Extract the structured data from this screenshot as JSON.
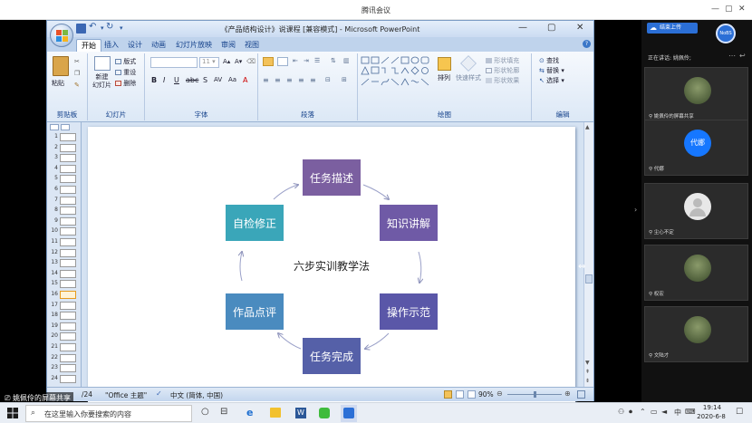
{
  "meeting": {
    "title": "腾讯会议",
    "now_speaking": "正在讲话: 姚佩伶;",
    "share_label": "姚佩伶的屏幕共享",
    "upload_btn": "结束上传"
  },
  "ppt": {
    "title": "《产品结构设计》说课程 [兼容模式] - Microsoft PowerPoint",
    "tabs": [
      "开始",
      "插入",
      "设计",
      "动画",
      "幻灯片放映",
      "审阅",
      "视图"
    ],
    "groups": {
      "clipboard": "剪贴板",
      "slides": "幻灯片",
      "font": "字体",
      "paragraph": "段落",
      "drawing": "绘图",
      "editing": "编辑"
    },
    "ribbon": {
      "paste": "粘贴",
      "new_slide": "新建\n幻灯片",
      "layout": "版式",
      "reset": "重设",
      "delete": "删除",
      "font_size": "11",
      "arrange": "排列",
      "quick_styles": "快速样式",
      "shape_fill": "形状填充",
      "shape_outline": "形状轮廓",
      "shape_effects": "形状效果",
      "find": "查找",
      "replace": "替换",
      "select": "选择"
    },
    "slide_numbers": [
      "1",
      "2",
      "3",
      "4",
      "5",
      "6",
      "7",
      "8",
      "9",
      "10",
      "11",
      "12",
      "13",
      "14",
      "15",
      "16",
      "17",
      "18",
      "19",
      "20",
      "21",
      "22",
      "23",
      "24"
    ],
    "current_slide": "16",
    "status": {
      "slide_count": "/24",
      "theme": "\"Office 主题\"",
      "language": "中文 (简体, 中国)",
      "zoom": "90%"
    },
    "diagram": {
      "center": "六步实训教学法",
      "steps": [
        "任务描述",
        "知识讲解",
        "操作示范",
        "任务完成",
        "作品点评",
        "自检修正"
      ]
    }
  },
  "participants": [
    {
      "name": "姚佩伶的屏幕共享",
      "avatar": "photo"
    },
    {
      "name": "代娜",
      "avatar": "代娜"
    },
    {
      "name": "尘心不定",
      "avatar": "default"
    },
    {
      "name": "权宏",
      "avatar": "photo"
    },
    {
      "name": "文陆才",
      "avatar": "photo"
    }
  ],
  "taskbar": {
    "search_placeholder": "在这里输入你要搜索的内容",
    "time": "19:14",
    "date": "2020-6-8",
    "ime": "中"
  },
  "colors": {
    "purple": "#7b5fa0",
    "teal": "#3aa6b9",
    "blue": "#4a8bbf",
    "indigo": "#5560a8"
  }
}
